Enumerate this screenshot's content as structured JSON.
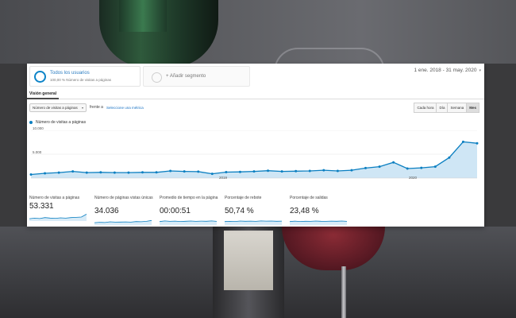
{
  "segments": {
    "active": {
      "title": "Todos los usuarios",
      "subtitle": "100,00 % Número de visitas a páginas"
    },
    "add_label": "+ Añadir segmento"
  },
  "date_range": "1 ene. 2018 - 31 may. 2020",
  "tabs": [
    {
      "label": "Visión general",
      "active": true
    }
  ],
  "controls": {
    "metric_select": "Número de visitas a páginas",
    "vs_label": "frente a",
    "select_metric_link": "Seleccione una métrica",
    "granularity": [
      {
        "label": "Cada hora",
        "active": false
      },
      {
        "label": "Día",
        "active": false
      },
      {
        "label": "Semana",
        "active": false
      },
      {
        "label": "Mes",
        "active": true
      }
    ]
  },
  "legend": {
    "series_name": "Número de visitas a páginas",
    "color": "#0b7fc1"
  },
  "chart_data": {
    "type": "area",
    "x": [
      "2018-01",
      "2018-02",
      "2018-03",
      "2018-04",
      "2018-05",
      "2018-06",
      "2018-07",
      "2018-08",
      "2018-09",
      "2018-10",
      "2018-11",
      "2018-12",
      "2019-01",
      "2019-02",
      "2019-03",
      "2019-04",
      "2019-05",
      "2019-06",
      "2019-07",
      "2019-08",
      "2019-09",
      "2019-10",
      "2019-11",
      "2019-12",
      "2020-01",
      "2020-02",
      "2020-03",
      "2020-04",
      "2020-05"
    ],
    "series": [
      {
        "name": "Número de visitas a páginas",
        "values": [
          750,
          1000,
          1150,
          1400,
          1150,
          1200,
          1150,
          1150,
          1200,
          1200,
          1500,
          1400,
          1350,
          900,
          1250,
          1300,
          1400,
          1550,
          1400,
          1450,
          1500,
          1650,
          1500,
          1650,
          2100,
          2400,
          3300,
          2000,
          2150,
          2400,
          4300,
          7600,
          7300
        ]
      }
    ],
    "y_ticks": [
      "10.000",
      "5.000"
    ],
    "x_ticks": [
      "2019",
      "2020"
    ],
    "ylim": [
      0,
      10000
    ],
    "fill_color": "#cfe6f5",
    "line_color": "#0b7fc1"
  },
  "summary": [
    {
      "label": "Número de visitas a páginas",
      "value": "53.331"
    },
    {
      "label": "Número de páginas vistas únicas",
      "value": "34.036"
    },
    {
      "label": "Promedio de tiempo en la página",
      "value": "00:00:51"
    },
    {
      "label": "Porcentaje de rebote",
      "value": "50,74 %"
    },
    {
      "label": "Porcentaje de salidas",
      "value": "23,48 %"
    }
  ]
}
